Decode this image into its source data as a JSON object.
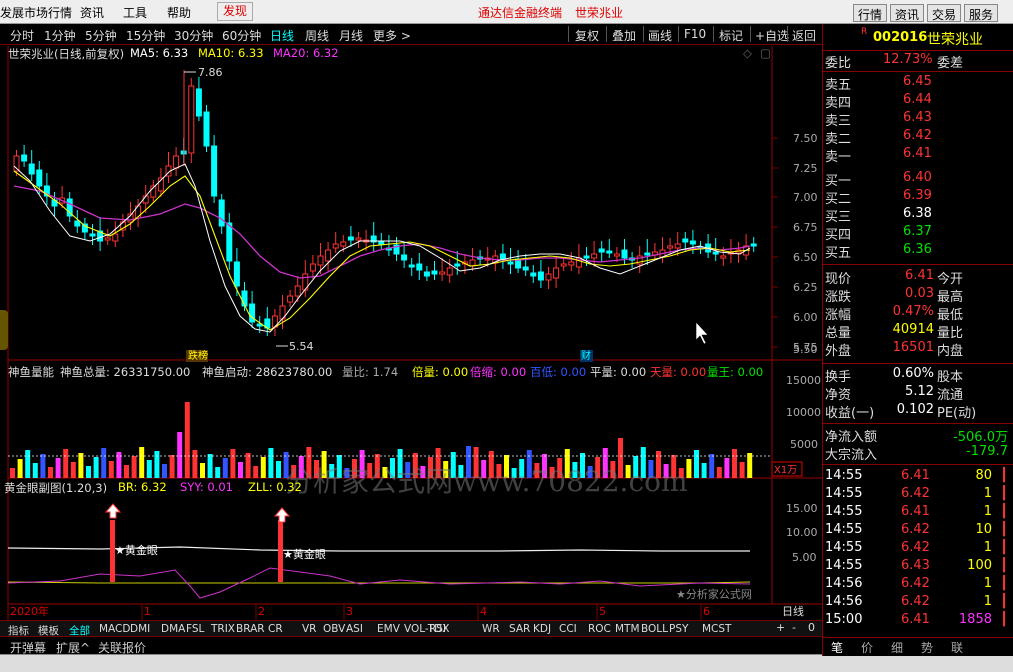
{
  "menubar": {
    "items": [
      "发展市场行情",
      "资讯",
      "工具",
      "帮助",
      "发现"
    ],
    "center_items": [
      "通达信金融终端",
      "世荣兆业"
    ],
    "right_buttons": [
      "行情",
      "资讯",
      "交易",
      "服务"
    ]
  },
  "toolbar": {
    "left": [
      "分时",
      "1分钟",
      "5分钟",
      "15分钟",
      "30分钟",
      "60分钟",
      "日线",
      "周线",
      "月线",
      "更多 >"
    ],
    "right": [
      "复权",
      "叠加",
      "画线",
      "F10",
      "标记",
      "+自选",
      "返回"
    ]
  },
  "main_chart": {
    "title": "世荣兆业(日线,前复权)",
    "ma5": "MA5: 6.33",
    "ma10": "MA10: 6.33",
    "ma20": "MA20: 6.32",
    "high_label": "7.86",
    "low_label": "5.54",
    "axis": [
      "7.50",
      "7.25",
      "7.00",
      "6.75",
      "6.50",
      "6.25",
      "6.00",
      "5.75",
      "5.50"
    ],
    "marks": [
      "跌榜",
      "财"
    ]
  },
  "vol_panel": {
    "legend": [
      "神鱼量能",
      "神鱼总量: 26331750.00",
      "神鱼启动: 28623780.00",
      "量比: 1.74",
      "倍量: 0.00",
      "倍缩: 0.00",
      "百低: 0.00",
      "平量: 0.00",
      "天量: 0.00",
      "量王: 0.00"
    ],
    "axis": [
      "15000",
      "10000",
      "5000"
    ],
    "unit": "X1万"
  },
  "gold_panel": {
    "legend": [
      "黄金眼副图(1.20,3)",
      "BR: 6.32",
      "SYY: 0.01",
      "ZLL: 0.32"
    ],
    "axis": [
      "15.00",
      "10.00",
      "5.00"
    ],
    "label": "★黄金眼",
    "watermark": "分析家公式网www.70822.com",
    "credit": "★分析家公式网"
  },
  "date_axis": {
    "year": "2020年",
    "months": [
      "1",
      "2",
      "3",
      "4",
      "5",
      "6"
    ],
    "period": "日线"
  },
  "indicator_tabs": [
    "指标",
    "模板",
    "全部",
    "MACD",
    "DMI",
    "DMA",
    "FSL",
    "TRIX",
    "BRAR",
    "CR",
    "VR",
    "OBV",
    "ASI",
    "EMV",
    "VOL-TDX",
    "RSI",
    "WR",
    "SAR",
    "KDJ",
    "CCI",
    "ROC",
    "MTM",
    "BOLL",
    "PSY",
    "MCST"
  ],
  "bottom_tabs": [
    "开弹幕",
    "扩展^",
    "关联报价"
  ],
  "nav_buttons": [
    "+",
    "-",
    "0"
  ],
  "quote": {
    "code": "002016",
    "name": "世荣兆业",
    "flag": "R",
    "webi": "委比",
    "webi_val": "12.73%",
    "weicha": "委差",
    "sells": [
      [
        "卖五",
        "6.45"
      ],
      [
        "卖四",
        "6.44"
      ],
      [
        "卖三",
        "6.43"
      ],
      [
        "卖二",
        "6.42"
      ],
      [
        "卖一",
        "6.41"
      ]
    ],
    "buys": [
      [
        "买一",
        "6.40"
      ],
      [
        "买二",
        "6.39"
      ],
      [
        "买三",
        "6.38"
      ],
      [
        "买四",
        "6.37"
      ],
      [
        "买五",
        "6.36"
      ]
    ],
    "stats": [
      [
        "现价",
        "6.41",
        "今开"
      ],
      [
        "涨跌",
        "0.03",
        "最高"
      ],
      [
        "涨幅",
        "0.47%",
        "最低"
      ],
      [
        "总量",
        "40914",
        "量比"
      ],
      [
        "外盘",
        "16501",
        "内盘"
      ]
    ],
    "stats2": [
      [
        "换手",
        "0.60%",
        "股本"
      ],
      [
        "净资",
        "5.12",
        "流通"
      ],
      [
        "收益(一)",
        "0.102",
        "PE(动)"
      ]
    ],
    "flow": [
      [
        "净流入额",
        "-506.0万"
      ],
      [
        "大宗流入",
        "-179.7"
      ]
    ],
    "ticks": [
      [
        "14:55",
        "6.41",
        "80"
      ],
      [
        "14:55",
        "6.42",
        "1"
      ],
      [
        "14:55",
        "6.41",
        "1"
      ],
      [
        "14:55",
        "6.42",
        "10"
      ],
      [
        "14:55",
        "6.42",
        "1"
      ],
      [
        "14:55",
        "6.43",
        "100"
      ],
      [
        "14:56",
        "6.42",
        "1"
      ],
      [
        "14:56",
        "6.42",
        "1"
      ],
      [
        "15:00",
        "6.41",
        "1858"
      ]
    ],
    "bottom_tabs": [
      "笔",
      "价",
      "细",
      "势",
      "联"
    ]
  },
  "colors": {
    "red": "#ff3333",
    "green": "#00e000",
    "yellow": "#ffff00",
    "white": "#ffffff",
    "magenta": "#ff33ff",
    "cyan": "#00ffff"
  }
}
